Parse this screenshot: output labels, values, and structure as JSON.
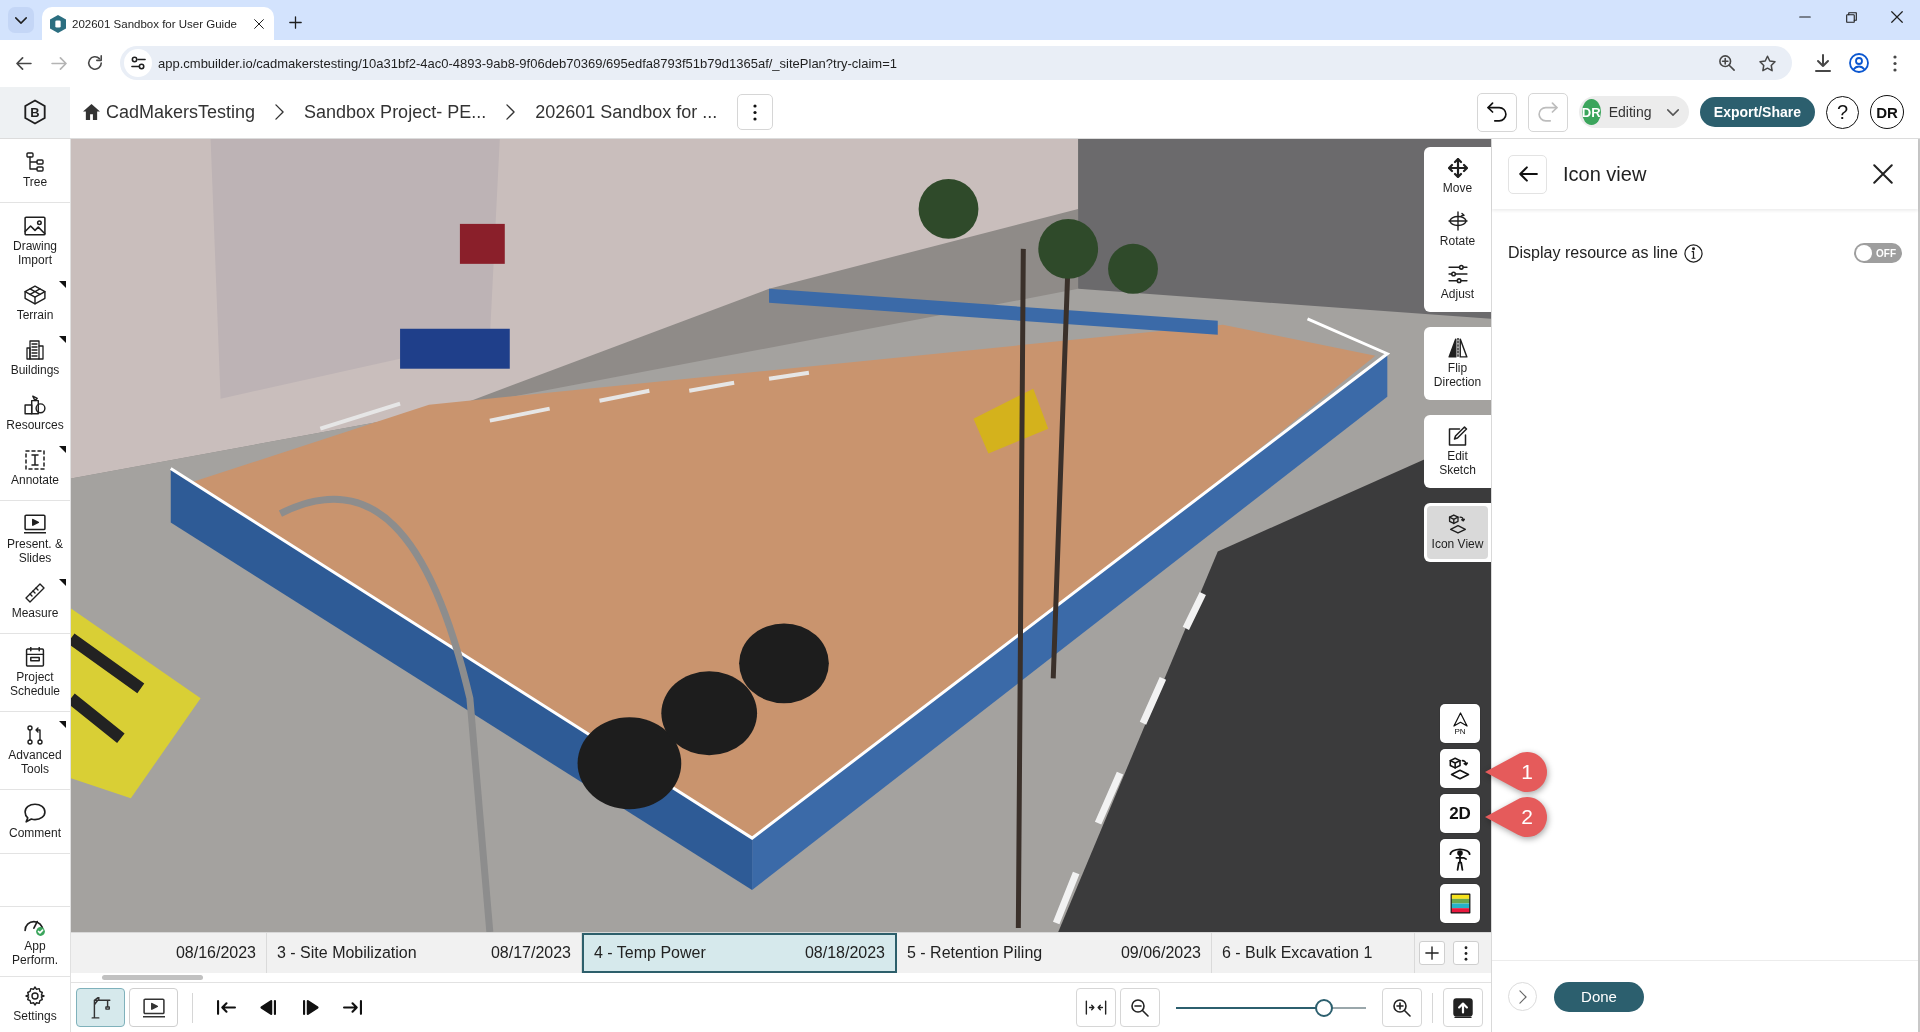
{
  "browser": {
    "tab_title": "202601 Sandbox for User Guide",
    "url": "app.cmbuilder.io/cadmakerstesting/10a31bf2-4ac0-4893-9ab8-9f06deb70369/695edfa8793f51b79d1365af/_sitePlan?try-claim=1",
    "forward_disabled": true
  },
  "header": {
    "logo": "B",
    "breadcrumbs": [
      {
        "kind": "home",
        "label": "CadMakersTesting"
      },
      {
        "kind": "page",
        "label": "Sandbox Project- PE..."
      },
      {
        "kind": "page",
        "label": "202601 Sandbox for ..."
      }
    ],
    "undo_disabled": false,
    "redo_disabled": true,
    "mode": {
      "initials": "DR",
      "label": "Editing"
    },
    "export_button": "Export/Share",
    "help_button": "?",
    "user_initials": "DR"
  },
  "sidebar": {
    "groups": [
      {
        "items": [
          {
            "label": "Tree",
            "has_submenu": false
          }
        ]
      },
      {
        "items": [
          {
            "label": "Drawing Import",
            "has_submenu": false
          },
          {
            "label": "Terrain",
            "has_submenu": true
          },
          {
            "label": "Buildings",
            "has_submenu": true
          },
          {
            "label": "Resources",
            "has_submenu": false
          },
          {
            "label": "Annotate",
            "has_submenu": true
          }
        ]
      },
      {
        "items": [
          {
            "label": "Present. & Slides",
            "has_submenu": false
          },
          {
            "label": "Measure",
            "has_submenu": true
          }
        ]
      },
      {
        "items": [
          {
            "label": "Project Schedule",
            "has_submenu": false
          }
        ]
      },
      {
        "items": [
          {
            "label": "Advanced Tools",
            "has_submenu": true
          }
        ]
      },
      {
        "items": [
          {
            "label": "Comment",
            "has_submenu": false
          }
        ]
      }
    ],
    "bottom_items": [
      {
        "label": "App Perform.",
        "has_submenu": false
      },
      {
        "label": "Settings",
        "has_submenu": false
      }
    ]
  },
  "viewport": {
    "tool_groups": [
      {
        "tools": [
          {
            "label": "Move",
            "selected": false
          },
          {
            "label": "Rotate",
            "selected": false
          },
          {
            "label": "Adjust",
            "selected": false
          }
        ]
      },
      {
        "tools": [
          {
            "label": "Flip Direction",
            "selected": false
          }
        ]
      },
      {
        "tools": [
          {
            "label": "Edit Sketch",
            "selected": false
          }
        ]
      },
      {
        "tools": [
          {
            "label": "Icon View",
            "selected": true
          }
        ]
      }
    ],
    "north_label": "PN",
    "view_mode_label": "2D",
    "callouts": [
      "1",
      "2"
    ]
  },
  "timeline": {
    "phases": [
      {
        "date": "08/16/2023",
        "selected": false
      },
      {
        "name": "3 - Site Mobilization",
        "date": "08/17/2023",
        "selected": false
      },
      {
        "name": "4 - Temp Power",
        "date": "08/18/2023",
        "selected": true
      },
      {
        "name": "5 - Retention Piling",
        "date": "09/06/2023",
        "selected": false
      },
      {
        "name": "6 - Bulk Excavation 1",
        "selected": false
      }
    ],
    "view_toggles": [
      {
        "selected": true
      },
      {
        "selected": false
      }
    ],
    "zoom": {
      "level": 0.78
    }
  },
  "panel": {
    "title": "Icon view",
    "options": [
      {
        "label": "Display resource as line",
        "on": false,
        "state_label": "OFF"
      }
    ],
    "done_button": "Done"
  }
}
